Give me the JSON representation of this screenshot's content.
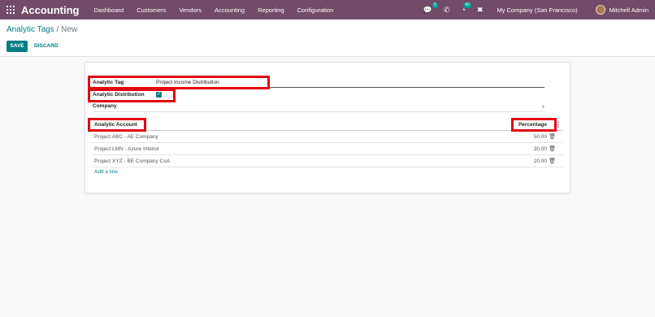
{
  "navbar": {
    "brand": "Accounting",
    "menu": [
      "Dashboard",
      "Customers",
      "Vendors",
      "Accounting",
      "Reporting",
      "Configuration"
    ],
    "chat_badge": "5",
    "activity_badge": "42",
    "company": "My Company (San Francisco)",
    "user": "Mitchell Admin",
    "accent": "#714b67"
  },
  "breadcrumb": {
    "parent": "Analytic Tags",
    "separator": " / ",
    "current": "New"
  },
  "actions": {
    "save": "SAVE",
    "discard": "DISCARD"
  },
  "form": {
    "tag_label": "Analytic Tag",
    "tag_value": "Project Income Distribution",
    "distribution_label": "Analytic Distribution",
    "distribution_checked": true,
    "company_label": "Company",
    "company_value": ""
  },
  "table": {
    "col_account": "Analytic Account",
    "col_percentage": "Percentage",
    "rows": [
      {
        "account": "Project ABC - AE Company",
        "percentage": "50.00"
      },
      {
        "account": "Project LMN - Azure Interior",
        "percentage": "30.00"
      },
      {
        "account": "Project XYZ - BE Company CoA",
        "percentage": "20.00"
      }
    ],
    "add_line": "Add a line"
  },
  "colors": {
    "primary": "#017e84",
    "highlight": "#e30613"
  }
}
